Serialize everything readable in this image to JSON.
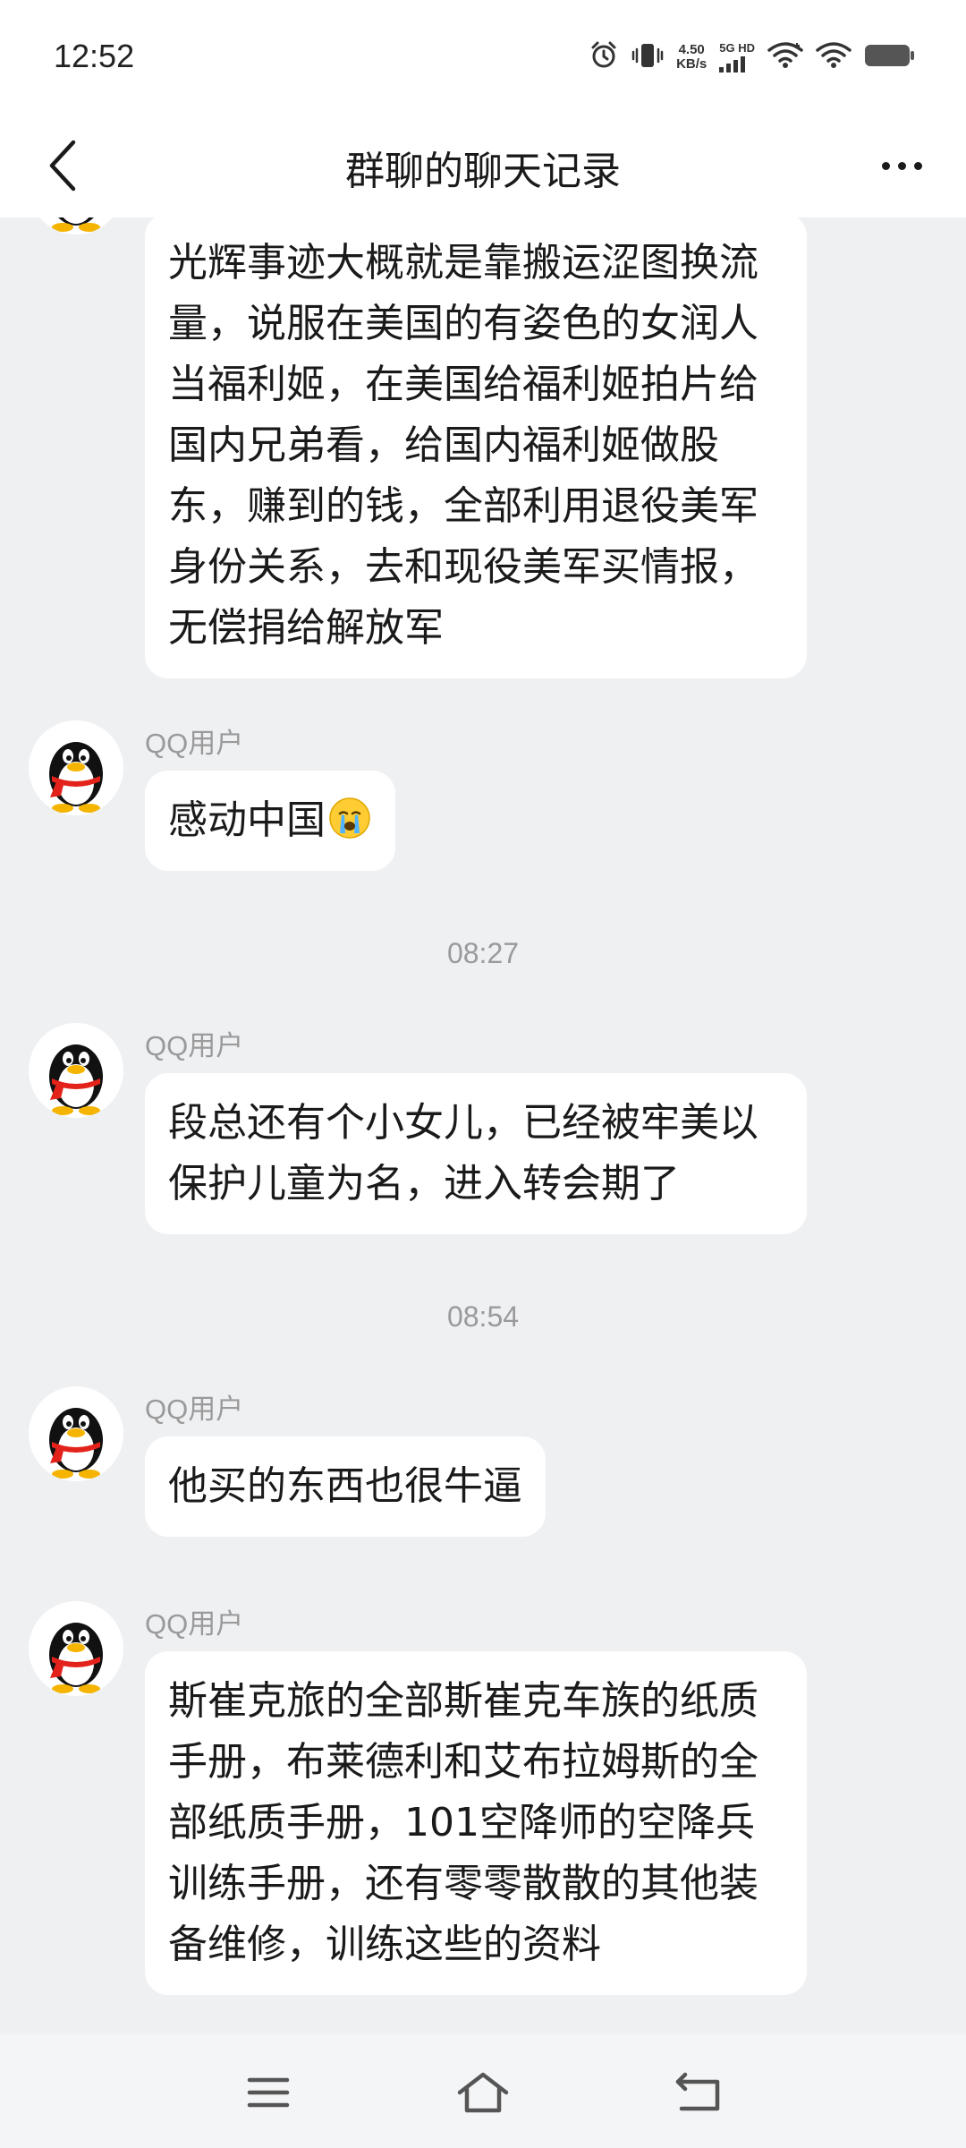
{
  "status_bar": {
    "time": "12:52",
    "net_speed_value": "4.50",
    "net_speed_unit": "KB/s",
    "network_type": "5G HD",
    "icons": [
      "alarm-icon",
      "vibrate-icon",
      "signal-icon",
      "wifi-icon",
      "wifi-icon",
      "battery-icon"
    ]
  },
  "nav": {
    "title": "群聊的聊天记录",
    "back_icon": "chevron-left-icon",
    "more_icon": "more-dots-icon"
  },
  "messages": [
    {
      "sender": "",
      "text": "光辉事迹大概就是靠搬运涩图换流量，说服在美国的有姿色的女润人当福利姬，在美国给福利姬拍片给国内兄弟看，给国内福利姬做股东，赚到的钱，全部利用退役美军身份关系，去和现役美军买情报，无偿捐给解放军"
    },
    {
      "sender": "QQ用户",
      "text": "感动中国",
      "emoji": "crying-face"
    },
    {
      "sender": "QQ用户",
      "text": "段总还有个小女儿，已经被牢美以保护儿童为名，进入转会期了"
    },
    {
      "sender": "QQ用户",
      "text": "他买的东西也很牛逼"
    },
    {
      "sender": "QQ用户",
      "text": "斯崔克旅的全部斯崔克车族的纸质手册，布莱德利和艾布拉姆斯的全部纸质手册，101空降师的空降兵训练手册，还有零零散散的其他装备维修，训练这些的资料"
    }
  ],
  "timestamps": [
    "08:27",
    "08:54"
  ],
  "bottom_nav": {
    "icons": [
      "menu-icon",
      "home-icon",
      "back-icon"
    ]
  },
  "colors": {
    "chat_background": "#eff0f2",
    "bubble": "#ffffff",
    "meta_text": "#9a9a9a",
    "avatar_scarf": "#e3231b"
  }
}
